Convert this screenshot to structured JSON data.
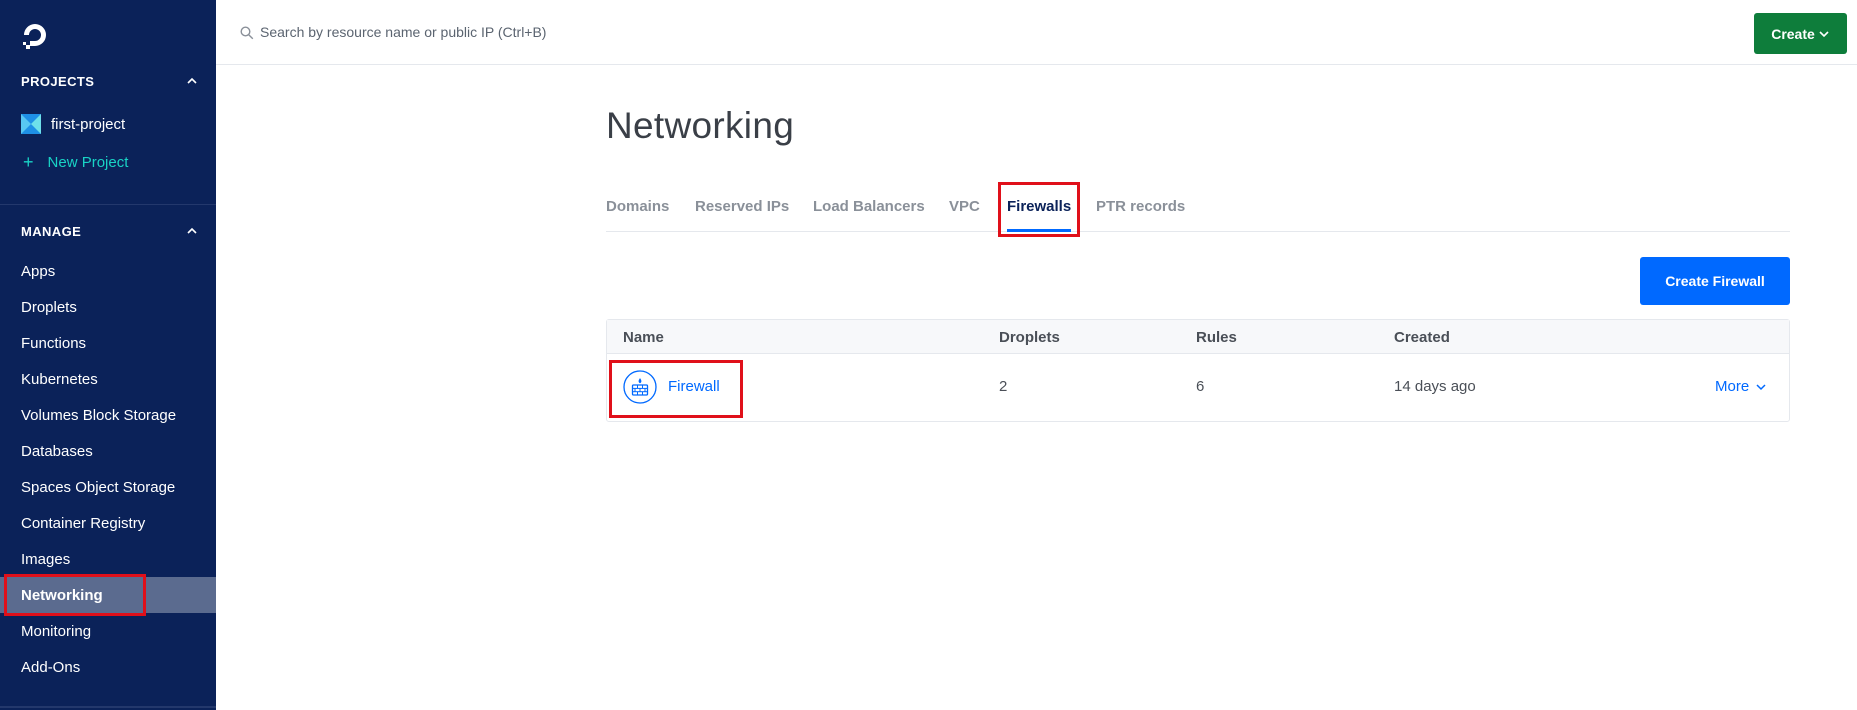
{
  "sidebar": {
    "logo_icon": "digitalocean-logo-icon",
    "projects_heading": "PROJECTS",
    "project_name": "first-project",
    "new_project_label": "New Project",
    "manage_heading": "MANAGE",
    "items": [
      {
        "label": "Apps",
        "active": false
      },
      {
        "label": "Droplets",
        "active": false
      },
      {
        "label": "Functions",
        "active": false
      },
      {
        "label": "Kubernetes",
        "active": false
      },
      {
        "label": "Volumes Block Storage",
        "active": false
      },
      {
        "label": "Databases",
        "active": false
      },
      {
        "label": "Spaces Object Storage",
        "active": false
      },
      {
        "label": "Container Registry",
        "active": false
      },
      {
        "label": "Images",
        "active": false
      },
      {
        "label": "Networking",
        "active": true
      },
      {
        "label": "Monitoring",
        "active": false
      },
      {
        "label": "Add-Ons",
        "active": false
      }
    ]
  },
  "topbar": {
    "search_placeholder": "Search by resource name or public IP (Ctrl+B)",
    "create_label": "Create"
  },
  "main": {
    "title": "Networking",
    "tabs": [
      {
        "label": "Domains",
        "active": false
      },
      {
        "label": "Reserved IPs",
        "active": false
      },
      {
        "label": "Load Balancers",
        "active": false
      },
      {
        "label": "VPC",
        "active": false
      },
      {
        "label": "Firewalls",
        "active": true
      },
      {
        "label": "PTR records",
        "active": false
      }
    ],
    "create_firewall_label": "Create Firewall",
    "table": {
      "columns": [
        "Name",
        "Droplets",
        "Rules",
        "Created"
      ],
      "rows": [
        {
          "name": "Firewall",
          "droplets": "2",
          "rules": "6",
          "created": "14 days ago",
          "action": "More"
        }
      ]
    }
  },
  "colors": {
    "sidebar_bg": "#0b2259",
    "accent_teal": "#19d3c5",
    "primary_blue": "#0069ff",
    "create_green": "#0e7d3b",
    "highlight_red": "#e0101a"
  }
}
